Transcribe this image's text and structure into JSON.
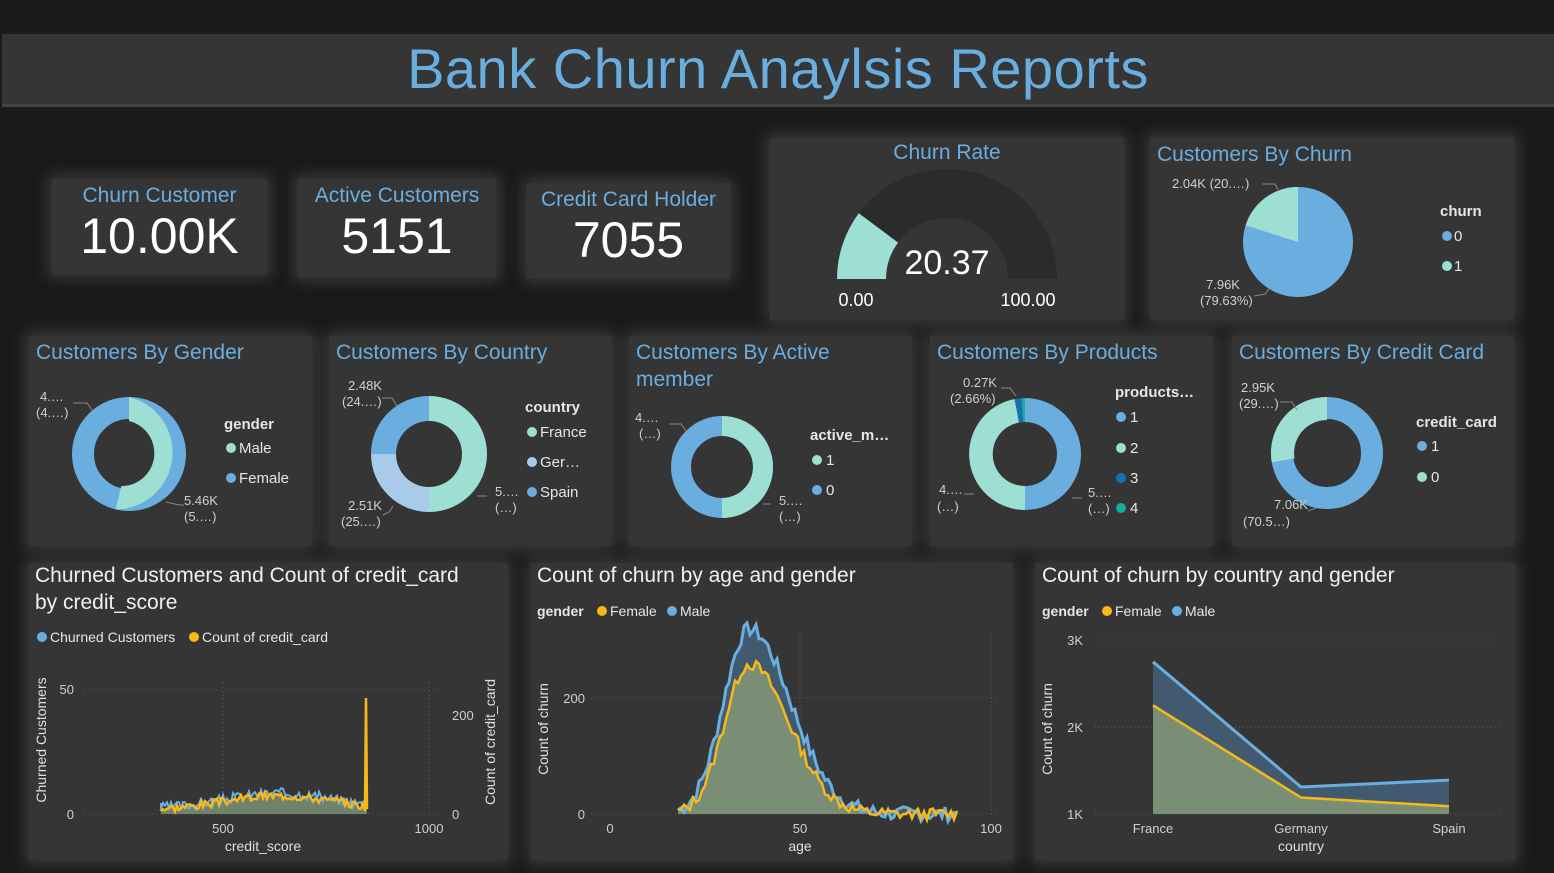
{
  "title": "Bank Churn Anaylsis Reports",
  "colors": {
    "accent": "#6aaee0",
    "churn": "#6aaee0",
    "male": "#6aaee0",
    "female": "#f7b81a",
    "mint": "#9de0d3",
    "light_blue": "#a9cbea",
    "dark_blue": "#1a6fb0",
    "teal": "#13b09a"
  },
  "kpis": [
    {
      "label": "Churn Customer",
      "value": "10.00K"
    },
    {
      "label": "Active Customers",
      "value": "5151"
    },
    {
      "label": "Credit Card Holder",
      "value": "7055"
    }
  ],
  "gauge": {
    "title": "Churn Rate",
    "value": "20.37",
    "min": "0.00",
    "max": "100.00",
    "fraction": 0.2037
  },
  "churn_pie": {
    "title": "Customers By Churn",
    "legend_title": "churn",
    "legend": [
      "0",
      "1"
    ],
    "label_1": "2.04K (20.…)",
    "label_0": "7.96K",
    "label_0b": "(79.63%)"
  },
  "gender": {
    "title": "Customers By Gender",
    "legend_title": "gender",
    "legend": [
      "Male",
      "Female"
    ],
    "label_a": "4.…",
    "label_a2": "(4.…)",
    "label_b": "5.46K",
    "label_b2": "(5.…)"
  },
  "country": {
    "title": "Customers By Country",
    "legend_title": "country",
    "legend": [
      "France",
      "Ger…",
      "Spain"
    ],
    "label_a": "2.48K",
    "label_a2": "(24.…)",
    "label_b": "2.51K",
    "label_b2": "(25.…)",
    "label_c": "5.…",
    "label_c2": "(…)"
  },
  "active": {
    "title_1": "Customers By Active",
    "title_2": "member",
    "legend_title": "active_m…",
    "legend": [
      "1",
      "0"
    ],
    "label_a": "4.…",
    "label_a2": "(…)",
    "label_b": "5.…",
    "label_b2": "(…)"
  },
  "products": {
    "title": "Customers By Products",
    "legend_title": "products…",
    "legend": [
      "1",
      "2",
      "3",
      "4"
    ],
    "label_a": "0.27K",
    "label_a2": "(2.66%)",
    "label_b": "4.…",
    "label_b2": "(…)",
    "label_c": "5.…",
    "label_c2": "(…)"
  },
  "credit": {
    "title": "Customers By Credit Card",
    "legend_title": "credit_card",
    "legend": [
      "1",
      "0"
    ],
    "label_a": "2.95K",
    "label_a2": "(29.…)",
    "label_b": "7.06K",
    "label_b2": "(70.5…)"
  },
  "chart_data": [
    {
      "type": "area",
      "title": "Churned Customers and Count of credit_card by credit_score",
      "title_1": "Churned Customers and Count of credit_card",
      "title_2": "by credit_score",
      "series": [
        {
          "name": "Churned Customers"
        },
        {
          "name": "Count of credit_card"
        }
      ],
      "xlabel": "credit_score",
      "ylabel": "Churned Customers",
      "y2label": "Count of credit_card",
      "xticks": [
        "500",
        "1000"
      ],
      "yticks": [
        "0",
        "50"
      ],
      "y2ticks": [
        "0",
        "200"
      ],
      "xlim": [
        300,
        1000
      ],
      "ylim": [
        0,
        50
      ],
      "y2lim": [
        0,
        200
      ]
    },
    {
      "type": "area",
      "title": "Count of churn by age and gender",
      "legend_title": "gender",
      "series": [
        {
          "name": "Female"
        },
        {
          "name": "Male"
        }
      ],
      "xlabel": "age",
      "ylabel": "Count of churn",
      "xticks": [
        "0",
        "50",
        "100"
      ],
      "yticks": [
        "0",
        "200"
      ],
      "xlim": [
        0,
        100
      ],
      "ylim": [
        0,
        250
      ]
    },
    {
      "type": "area",
      "title": "Count of churn by country and gender",
      "legend_title": "gender",
      "categories": [
        "France",
        "Germany",
        "Spain"
      ],
      "series": [
        {
          "name": "Female",
          "values": [
            2250,
            1190,
            1090
          ]
        },
        {
          "name": "Male",
          "values": [
            2750,
            1310,
            1390
          ]
        }
      ],
      "xlabel": "country",
      "ylabel": "Count of churn",
      "yticks": [
        "1K",
        "2K",
        "3K"
      ],
      "ylim": [
        1000,
        3000
      ]
    }
  ]
}
